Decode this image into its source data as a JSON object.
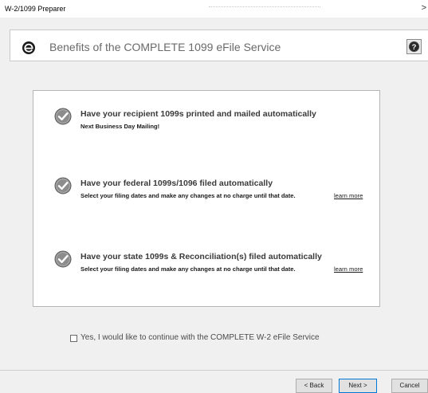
{
  "window": {
    "title": "W-2/1099 Preparer",
    "chevron": ">"
  },
  "header": {
    "logo_icon": "efile-e-icon",
    "title": "Benefits of the COMPLETE 1099 eFile Service",
    "help_icon": "help-question-icon"
  },
  "features": [
    {
      "title": "Have your recipient 1099s printed and mailed automatically",
      "subtitle": "Next Business Day Mailing!",
      "learn_more": ""
    },
    {
      "title": "Have your federal 1099s/1096 filed automatically",
      "subtitle": "Select your filing dates and make any changes at no charge until that date.",
      "learn_more": "learn more"
    },
    {
      "title": "Have your state 1099s & Reconciliation(s) filed automatically",
      "subtitle": "Select your filing dates and make any changes at no charge until that date.",
      "learn_more": "learn more"
    }
  ],
  "optin": {
    "label": "Yes, I would like to continue with the COMPLETE W-2 eFile Service",
    "checked": false
  },
  "buttons": {
    "back": "< Back",
    "next": "Next >",
    "cancel": "Cancel"
  },
  "colors": {
    "dialog_bg": "#f0f0f0",
    "panel_bg": "#ffffff",
    "header_title": "#6a6a6a",
    "check_fill": "#8c8c8c",
    "default_button_border": "#0078d7"
  }
}
